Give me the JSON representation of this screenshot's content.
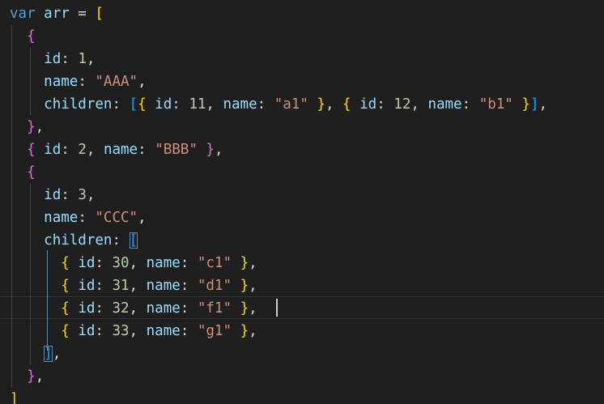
{
  "editor": {
    "language": "javascript",
    "colors": {
      "background": "#1f1f1f",
      "keyword": "#569cd6",
      "property": "#9cdcfe",
      "number": "#b5cea8",
      "string": "#ce9178",
      "bracket_gold": "#ffd700",
      "bracket_orchid": "#da70d6",
      "bracket_blue": "#179fff"
    },
    "lines": [
      [
        {
          "t": "var",
          "c": "kw"
        },
        {
          "t": " "
        },
        {
          "t": "arr",
          "c": "var"
        },
        {
          "t": " = ",
          "c": "p"
        },
        {
          "t": "[",
          "c": "b1"
        }
      ],
      [
        {
          "t": "  "
        },
        {
          "t": "{",
          "c": "b2"
        }
      ],
      [
        {
          "t": "    "
        },
        {
          "t": "id",
          "c": "prop"
        },
        {
          "t": ": ",
          "c": "p"
        },
        {
          "t": "1",
          "c": "num"
        },
        {
          "t": ",",
          "c": "p"
        }
      ],
      [
        {
          "t": "    "
        },
        {
          "t": "name",
          "c": "prop"
        },
        {
          "t": ": ",
          "c": "p"
        },
        {
          "t": "\"AAA\"",
          "c": "str"
        },
        {
          "t": ",",
          "c": "p"
        }
      ],
      [
        {
          "t": "    "
        },
        {
          "t": "children",
          "c": "prop"
        },
        {
          "t": ": ",
          "c": "p"
        },
        {
          "t": "[",
          "c": "b3"
        },
        {
          "t": "{",
          "c": "b1"
        },
        {
          "t": " "
        },
        {
          "t": "id",
          "c": "prop"
        },
        {
          "t": ": ",
          "c": "p"
        },
        {
          "t": "11",
          "c": "num"
        },
        {
          "t": ", ",
          "c": "p"
        },
        {
          "t": "name",
          "c": "prop"
        },
        {
          "t": ": ",
          "c": "p"
        },
        {
          "t": "\"a1\"",
          "c": "str"
        },
        {
          "t": " "
        },
        {
          "t": "}",
          "c": "b1"
        },
        {
          "t": ", ",
          "c": "p"
        },
        {
          "t": "{",
          "c": "b1"
        },
        {
          "t": " "
        },
        {
          "t": "id",
          "c": "prop"
        },
        {
          "t": ": ",
          "c": "p"
        },
        {
          "t": "12",
          "c": "num"
        },
        {
          "t": ", ",
          "c": "p"
        },
        {
          "t": "name",
          "c": "prop"
        },
        {
          "t": ": ",
          "c": "p"
        },
        {
          "t": "\"b1\"",
          "c": "str"
        },
        {
          "t": " "
        },
        {
          "t": "}",
          "c": "b1"
        },
        {
          "t": "]",
          "c": "b3"
        },
        {
          "t": ",",
          "c": "p"
        }
      ],
      [
        {
          "t": "  "
        },
        {
          "t": "}",
          "c": "b2"
        },
        {
          "t": ",",
          "c": "p"
        }
      ],
      [
        {
          "t": "  "
        },
        {
          "t": "{",
          "c": "b2"
        },
        {
          "t": " "
        },
        {
          "t": "id",
          "c": "prop"
        },
        {
          "t": ": ",
          "c": "p"
        },
        {
          "t": "2",
          "c": "num"
        },
        {
          "t": ", ",
          "c": "p"
        },
        {
          "t": "name",
          "c": "prop"
        },
        {
          "t": ": ",
          "c": "p"
        },
        {
          "t": "\"BBB\"",
          "c": "str"
        },
        {
          "t": " "
        },
        {
          "t": "}",
          "c": "b2"
        },
        {
          "t": ",",
          "c": "p"
        }
      ],
      [
        {
          "t": "  "
        },
        {
          "t": "{",
          "c": "b2"
        }
      ],
      [
        {
          "t": "    "
        },
        {
          "t": "id",
          "c": "prop"
        },
        {
          "t": ": ",
          "c": "p"
        },
        {
          "t": "3",
          "c": "num"
        },
        {
          "t": ",",
          "c": "p"
        }
      ],
      [
        {
          "t": "    "
        },
        {
          "t": "name",
          "c": "prop"
        },
        {
          "t": ": ",
          "c": "p"
        },
        {
          "t": "\"CCC\"",
          "c": "str"
        },
        {
          "t": ",",
          "c": "p"
        }
      ],
      [
        {
          "t": "    "
        },
        {
          "t": "children",
          "c": "prop"
        },
        {
          "t": ": ",
          "c": "p"
        },
        {
          "t": "[",
          "c": "b3 match"
        }
      ],
      [
        {
          "t": "      "
        },
        {
          "t": "{",
          "c": "b1"
        },
        {
          "t": " "
        },
        {
          "t": "id",
          "c": "prop"
        },
        {
          "t": ": ",
          "c": "p"
        },
        {
          "t": "30",
          "c": "num"
        },
        {
          "t": ", ",
          "c": "p"
        },
        {
          "t": "name",
          "c": "prop"
        },
        {
          "t": ": ",
          "c": "p"
        },
        {
          "t": "\"c1\"",
          "c": "str"
        },
        {
          "t": " "
        },
        {
          "t": "}",
          "c": "b1"
        },
        {
          "t": ",",
          "c": "p"
        }
      ],
      [
        {
          "t": "      "
        },
        {
          "t": "{",
          "c": "b1"
        },
        {
          "t": " "
        },
        {
          "t": "id",
          "c": "prop"
        },
        {
          "t": ": ",
          "c": "p"
        },
        {
          "t": "31",
          "c": "num"
        },
        {
          "t": ", ",
          "c": "p"
        },
        {
          "t": "name",
          "c": "prop"
        },
        {
          "t": ": ",
          "c": "p"
        },
        {
          "t": "\"d1\"",
          "c": "str"
        },
        {
          "t": " "
        },
        {
          "t": "}",
          "c": "b1"
        },
        {
          "t": ",",
          "c": "p"
        }
      ],
      [
        {
          "t": "      "
        },
        {
          "t": "{",
          "c": "b1"
        },
        {
          "t": " "
        },
        {
          "t": "id",
          "c": "prop"
        },
        {
          "t": ": ",
          "c": "p"
        },
        {
          "t": "32",
          "c": "num"
        },
        {
          "t": ", ",
          "c": "p"
        },
        {
          "t": "name",
          "c": "prop"
        },
        {
          "t": ": ",
          "c": "p"
        },
        {
          "t": "\"f1\"",
          "c": "str"
        },
        {
          "t": " "
        },
        {
          "t": "}",
          "c": "b1"
        },
        {
          "t": ",",
          "c": "p"
        }
      ],
      [
        {
          "t": "      "
        },
        {
          "t": "{",
          "c": "b1"
        },
        {
          "t": " "
        },
        {
          "t": "id",
          "c": "prop"
        },
        {
          "t": ": ",
          "c": "p"
        },
        {
          "t": "33",
          "c": "num"
        },
        {
          "t": ", ",
          "c": "p"
        },
        {
          "t": "name",
          "c": "prop"
        },
        {
          "t": ": ",
          "c": "p"
        },
        {
          "t": "\"g1\"",
          "c": "str"
        },
        {
          "t": " "
        },
        {
          "t": "}",
          "c": "b1"
        },
        {
          "t": ",",
          "c": "p"
        }
      ],
      [
        {
          "t": "    "
        },
        {
          "t": "]",
          "c": "b3 match"
        },
        {
          "t": ",",
          "c": "p"
        }
      ],
      [
        {
          "t": "  "
        },
        {
          "t": "}",
          "c": "b2"
        },
        {
          "t": ",",
          "c": "p"
        }
      ],
      [
        {
          "t": "]",
          "c": "b1"
        }
      ]
    ]
  }
}
